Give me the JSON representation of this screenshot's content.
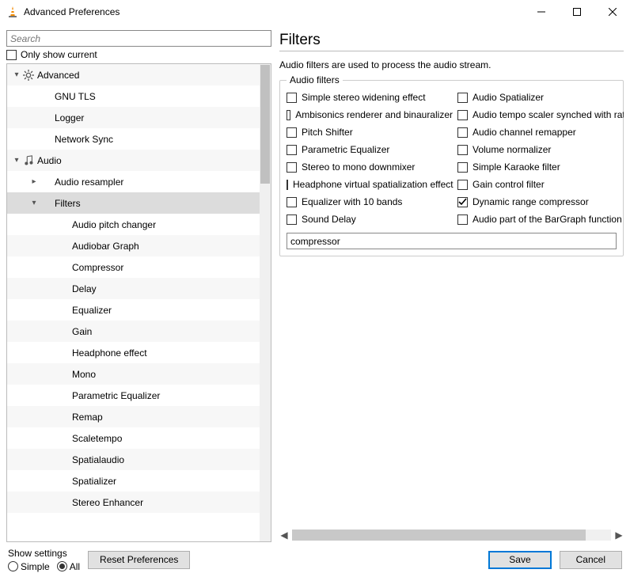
{
  "window": {
    "title": "Advanced Preferences"
  },
  "left": {
    "search_placeholder": "Search",
    "only_current": "Only show current",
    "tree": [
      {
        "indent": 0,
        "twisty": "down",
        "icon": "gear",
        "label": "Advanced"
      },
      {
        "indent": 1,
        "label": "GNU TLS"
      },
      {
        "indent": 1,
        "label": "Logger"
      },
      {
        "indent": 1,
        "label": "Network Sync"
      },
      {
        "indent": 0,
        "twisty": "down",
        "icon": "note",
        "label": "Audio"
      },
      {
        "indent": 1,
        "twisty": "right",
        "label": "Audio resampler"
      },
      {
        "indent": 1,
        "twisty": "down",
        "label": "Filters",
        "selected": true
      },
      {
        "indent": 2,
        "label": "Audio pitch changer"
      },
      {
        "indent": 2,
        "label": "Audiobar Graph"
      },
      {
        "indent": 2,
        "label": "Compressor"
      },
      {
        "indent": 2,
        "label": "Delay"
      },
      {
        "indent": 2,
        "label": "Equalizer"
      },
      {
        "indent": 2,
        "label": "Gain"
      },
      {
        "indent": 2,
        "label": "Headphone effect"
      },
      {
        "indent": 2,
        "label": "Mono"
      },
      {
        "indent": 2,
        "label": "Parametric Equalizer"
      },
      {
        "indent": 2,
        "label": "Remap"
      },
      {
        "indent": 2,
        "label": "Scaletempo"
      },
      {
        "indent": 2,
        "label": "Spatialaudio"
      },
      {
        "indent": 2,
        "label": "Spatializer"
      },
      {
        "indent": 2,
        "label": "Stereo Enhancer"
      }
    ]
  },
  "right": {
    "title": "Filters",
    "description": "Audio filters are used to process the audio stream.",
    "group_legend": "Audio filters",
    "checks": [
      {
        "label": "Simple stereo widening effect",
        "checked": false
      },
      {
        "label": "Audio Spatializer",
        "checked": false
      },
      {
        "label": "Ambisonics renderer and binauralizer",
        "checked": false
      },
      {
        "label": "Audio tempo scaler synched with rate",
        "checked": false
      },
      {
        "label": "Pitch Shifter",
        "checked": false
      },
      {
        "label": "Audio channel remapper",
        "checked": false
      },
      {
        "label": "Parametric Equalizer",
        "checked": false
      },
      {
        "label": "Volume normalizer",
        "checked": false
      },
      {
        "label": "Stereo to mono downmixer",
        "checked": false
      },
      {
        "label": "Simple Karaoke filter",
        "checked": false
      },
      {
        "label": "Headphone virtual spatialization effect",
        "checked": false
      },
      {
        "label": "Gain control filter",
        "checked": false
      },
      {
        "label": "Equalizer with 10 bands",
        "checked": false
      },
      {
        "label": "Dynamic range compressor",
        "checked": true
      },
      {
        "label": "Sound Delay",
        "checked": false
      },
      {
        "label": "Audio part of the BarGraph function",
        "checked": false
      }
    ],
    "filter_value": "compressor"
  },
  "footer": {
    "show_settings": "Show settings",
    "simple": "Simple",
    "all": "All",
    "reset": "Reset Preferences",
    "save": "Save",
    "cancel": "Cancel"
  }
}
